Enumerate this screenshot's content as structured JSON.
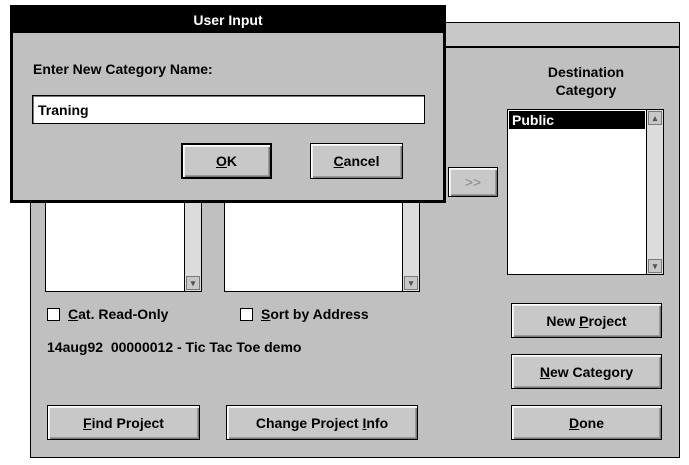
{
  "dialog": {
    "title": "User Input",
    "prompt": "Enter New Category Name:",
    "input_value": "Traning",
    "ok_prefix": "",
    "ok_mnemonic": "O",
    "ok_suffix": "K",
    "cancel_prefix": "",
    "cancel_mnemonic": "C",
    "cancel_suffix": "ancel"
  },
  "main": {
    "destination_label_line1": "Destination",
    "destination_label_line2": "Category",
    "destination_items": [
      "Public"
    ],
    "move_button_label": ">>",
    "cat_readonly": {
      "prefix": "",
      "mnemonic": "C",
      "suffix": "at. Read-Only",
      "checked": false
    },
    "sort_by_address": {
      "prefix": "",
      "mnemonic": "S",
      "suffix": "ort by Address",
      "checked": false
    },
    "status_text": "14aug92  00000012 - Tic Tac Toe demo",
    "buttons": {
      "new_project": {
        "prefix": "New ",
        "mnemonic": "P",
        "suffix": "roject"
      },
      "new_category": {
        "prefix": "",
        "mnemonic": "N",
        "suffix": "ew Category"
      },
      "done": {
        "prefix": "",
        "mnemonic": "D",
        "suffix": "one"
      },
      "find_project": {
        "prefix": "",
        "mnemonic": "F",
        "suffix": "ind Project"
      },
      "change_info": {
        "prefix": "Change Project ",
        "mnemonic": "I",
        "suffix": "nfo"
      }
    }
  },
  "icons": {
    "scroll_down": "▾",
    "scroll_up": "▴"
  }
}
